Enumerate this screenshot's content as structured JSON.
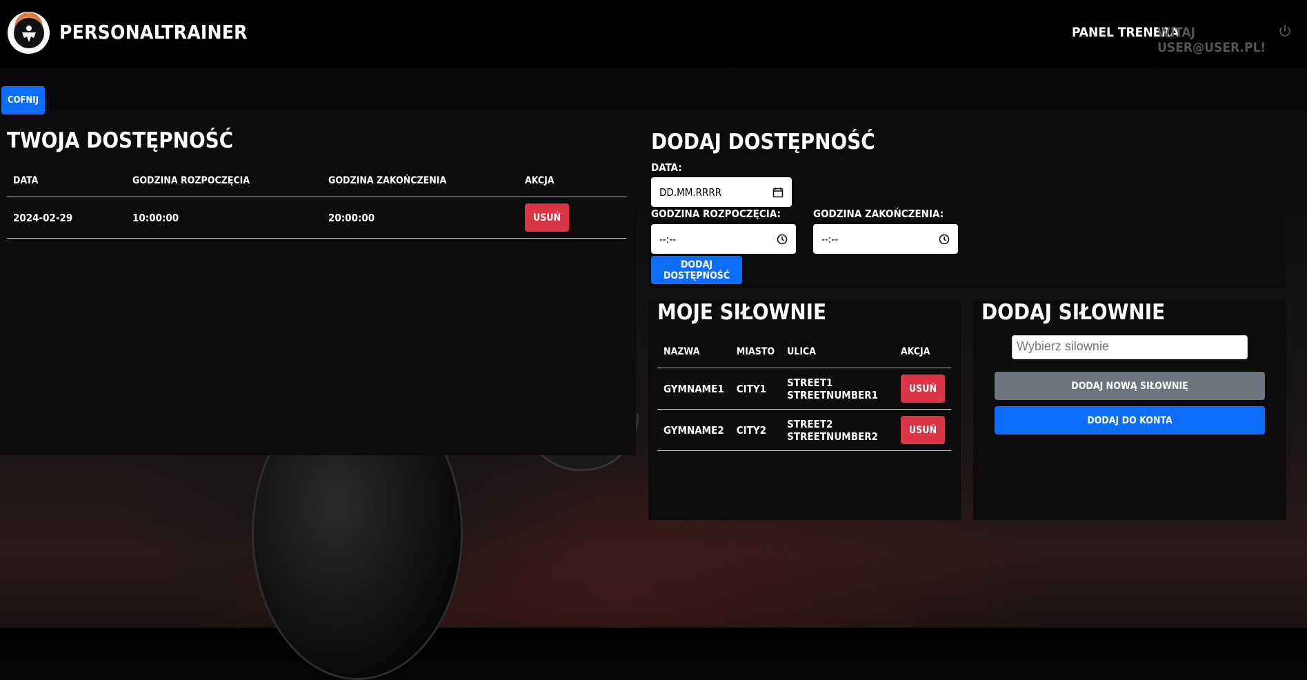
{
  "header": {
    "brand": "PERSONALTRAINER",
    "panel_link": "PANEL TRENERA",
    "user_greeting": "WITAJ USER@USER.PL!"
  },
  "back_button": "COFNIJ",
  "availability": {
    "title": "TWOJA DOSTĘPNOŚĆ",
    "columns": [
      "DATA",
      "GODZINA ROZPOCZĘCIA",
      "GODZINA ZAKOŃCZENIA",
      "AKCJA"
    ],
    "rows": [
      {
        "date": "2024-02-29",
        "start": "10:00:00",
        "end": "20:00:00",
        "action": "USUŃ"
      }
    ]
  },
  "add_availability": {
    "title": "DODAJ DOSTĘPNOŚĆ",
    "date_label": "DATA:",
    "date_placeholder": "DD.MM.RRRR",
    "start_label": "GODZINA ROZPOCZĘCIA:",
    "start_placeholder": "--:--",
    "end_label": "GODZINA ZAKOŃCZENIA:",
    "end_placeholder": "--:--",
    "submit": "DODAJ DOSTĘPNOŚĆ"
  },
  "my_gyms": {
    "title": "MOJE SIŁOWNIE",
    "columns": [
      "NAZWA",
      "MIASTO",
      "ULICA",
      "AKCJA"
    ],
    "rows": [
      {
        "name": "GYMNAME1",
        "city": "CITY1",
        "street": "STREET1 STREETNUMBER1",
        "action": "USUŃ"
      },
      {
        "name": "GYMNAME2",
        "city": "CITY2",
        "street": "STREET2 STREETNUMBER2",
        "action": "USUŃ"
      }
    ]
  },
  "add_gym": {
    "title": "DODAJ SIŁOWNIE",
    "select_placeholder": "Wybierz silownie",
    "new_gym_button": "DODAJ NOWĄ SIŁOWNIĘ",
    "add_to_account_button": "DODAJ DO KONTA"
  },
  "colors": {
    "primary": "#0d6efd",
    "danger": "#dc3545",
    "secondary": "#6c757d",
    "panel_bg": "#0c0c0c"
  },
  "icons": [
    "logo-icon",
    "power-icon",
    "calendar-icon",
    "clock-icon"
  ]
}
